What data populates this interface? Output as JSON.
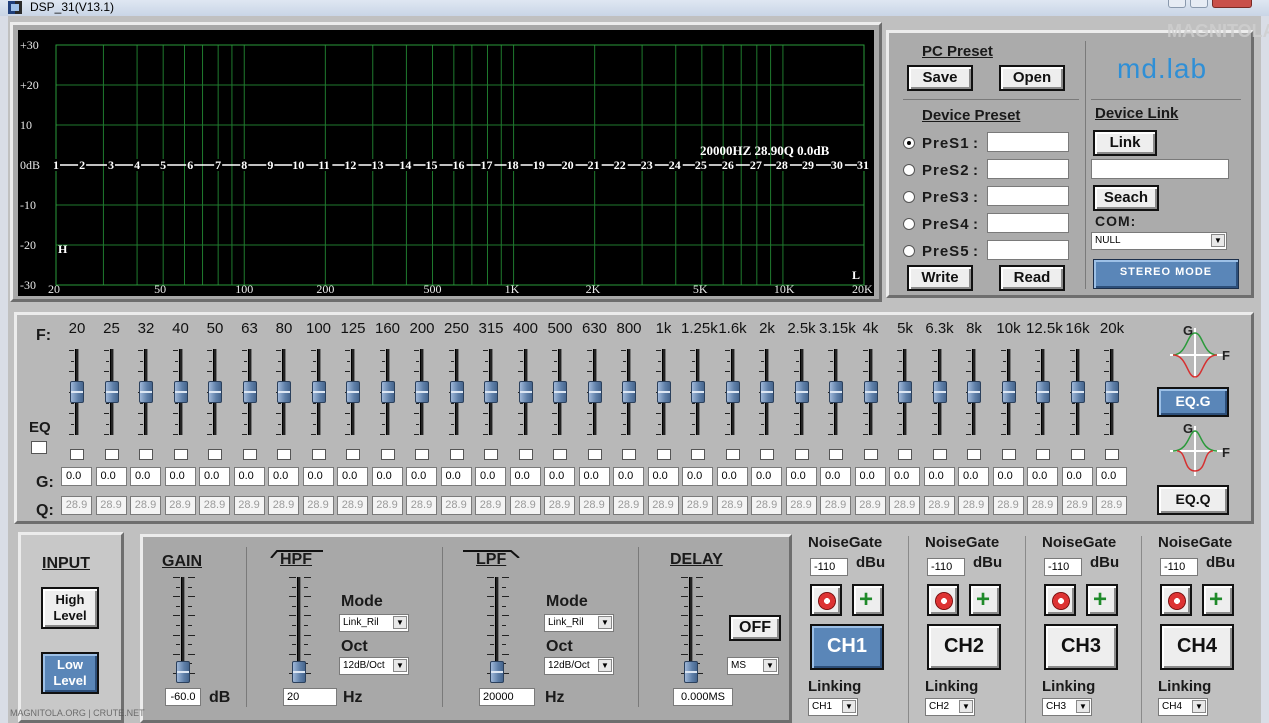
{
  "window": {
    "title": "DSP_31(V13.1)"
  },
  "graph": {
    "y_labels": [
      "+30",
      "+20",
      "10",
      "0dB",
      "-10",
      "-20",
      "-30"
    ],
    "x_labels": [
      "20",
      "50",
      "100",
      "200",
      "500",
      "1K",
      "2K",
      "5K",
      "10K",
      "20K"
    ],
    "band_markers": [
      "1",
      "2",
      "3",
      "4",
      "5",
      "6",
      "7",
      "8",
      "9",
      "10",
      "11",
      "12",
      "13",
      "14",
      "15",
      "16",
      "17",
      "18",
      "19",
      "20",
      "21",
      "22",
      "23",
      "24",
      "25",
      "26",
      "27",
      "28",
      "29",
      "30",
      "31"
    ],
    "readout": "20000HZ 28.90Q 0.0dB",
    "marker_h": "H",
    "marker_l": "L"
  },
  "preset": {
    "pc_title": "PC Preset",
    "save": "Save",
    "open": "Open",
    "logo": "md.lab",
    "watermark": "MAGNITOLA",
    "device_title": "Device Preset",
    "presets": [
      "PreS1",
      "PreS2",
      "PreS3",
      "PreS4",
      "PreS5"
    ],
    "colon": ":",
    "selected_preset": "PreS1",
    "write": "Write",
    "read": "Read",
    "link_title": "Device Link",
    "link": "Link",
    "seach": "Seach",
    "com_label": "COM:",
    "com_value": "NULL",
    "stereo": "STEREO MODE"
  },
  "eq": {
    "f_label": "F:",
    "g_label": "G:",
    "q_label": "Q:",
    "eq_label": "EQ",
    "bands": [
      "20",
      "25",
      "32",
      "40",
      "50",
      "63",
      "80",
      "100",
      "125",
      "160",
      "200",
      "250",
      "315",
      "400",
      "500",
      "630",
      "800",
      "1k",
      "1.25k",
      "1.6k",
      "2k",
      "2.5k",
      "3.15k",
      "4k",
      "5k",
      "6.3k",
      "8k",
      "10k",
      "12.5k",
      "16k",
      "20k"
    ],
    "gain_value": "0.0",
    "q_value": "28.9",
    "g_axis": "G",
    "f_axis": "F",
    "eqg_button": "EQ.G",
    "eqq_button": "EQ.Q"
  },
  "input": {
    "title": "INPUT",
    "high": "High Level",
    "low": "Low Level"
  },
  "filters": {
    "gain_title": "GAIN",
    "gain_value": "-60.0",
    "gain_unit": "dB",
    "hpf_title": "HPF",
    "hpf_mode_label": "Mode",
    "hpf_mode": "Link_Ril",
    "hpf_oct_label": "Oct",
    "hpf_oct": "12dB/Oct",
    "hpf_freq": "20",
    "hpf_unit": "Hz",
    "lpf_title": "LPF",
    "lpf_mode_label": "Mode",
    "lpf_mode": "Link_Ril",
    "lpf_oct_label": "Oct",
    "lpf_oct": "12dB/Oct",
    "lpf_freq": "20000",
    "lpf_unit": "Hz",
    "delay_title": "DELAY",
    "delay_toggle": "OFF",
    "delay_unit_select": "MS",
    "delay_value": "0.000MS"
  },
  "channels": [
    {
      "name": "CH1",
      "noisegate": "NoiseGate",
      "ng_value": "-110",
      "unit": "dBu",
      "linking": "Linking",
      "link_value": "CH1",
      "active": true
    },
    {
      "name": "CH2",
      "noisegate": "NoiseGate",
      "ng_value": "-110",
      "unit": "dBu",
      "linking": "Linking",
      "link_value": "CH2",
      "active": false
    },
    {
      "name": "CH3",
      "noisegate": "NoiseGate",
      "ng_value": "-110",
      "unit": "dBu",
      "linking": "Linking",
      "link_value": "CH3",
      "active": false
    },
    {
      "name": "CH4",
      "noisegate": "NoiseGate",
      "ng_value": "-110",
      "unit": "dBu",
      "linking": "Linking",
      "link_value": "CH4",
      "active": false
    }
  ],
  "footer_watermark": "MAGNITOLA.ORG | CRUTE.NET"
}
